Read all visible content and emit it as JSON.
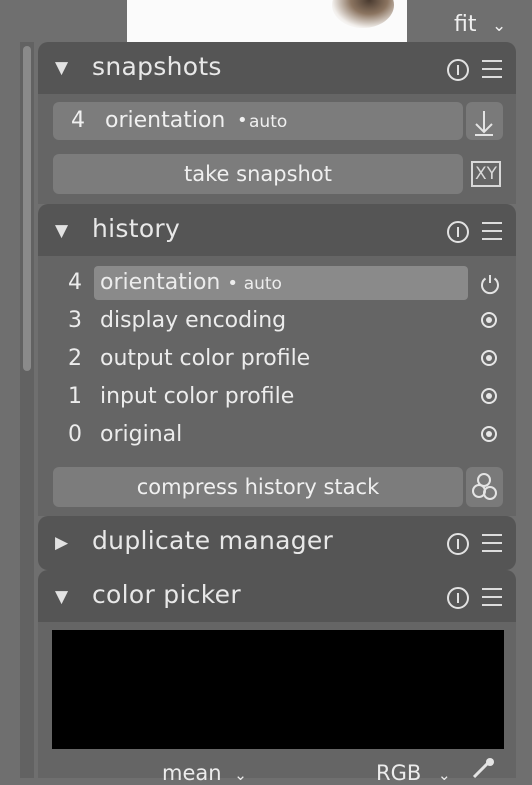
{
  "zoom": {
    "label": "fit"
  },
  "snapshots": {
    "title": "snapshots",
    "entry": {
      "number": "4",
      "label": "orientation",
      "sub": "auto"
    },
    "take_snapshot_label": "take snapshot",
    "compare_icon_label": "XY"
  },
  "history": {
    "title": "history",
    "items": [
      {
        "number": "4",
        "label": "orientation",
        "sub": "auto"
      },
      {
        "number": "3",
        "label": "display encoding",
        "sub": ""
      },
      {
        "number": "2",
        "label": "output color profile",
        "sub": ""
      },
      {
        "number": "1",
        "label": "input color profile",
        "sub": ""
      },
      {
        "number": "0",
        "label": "original",
        "sub": ""
      }
    ],
    "compress_label": "compress history stack"
  },
  "duplicate_manager": {
    "title": "duplicate manager"
  },
  "color_picker": {
    "title": "color picker",
    "mode": "mean",
    "colorspace": "RGB"
  }
}
